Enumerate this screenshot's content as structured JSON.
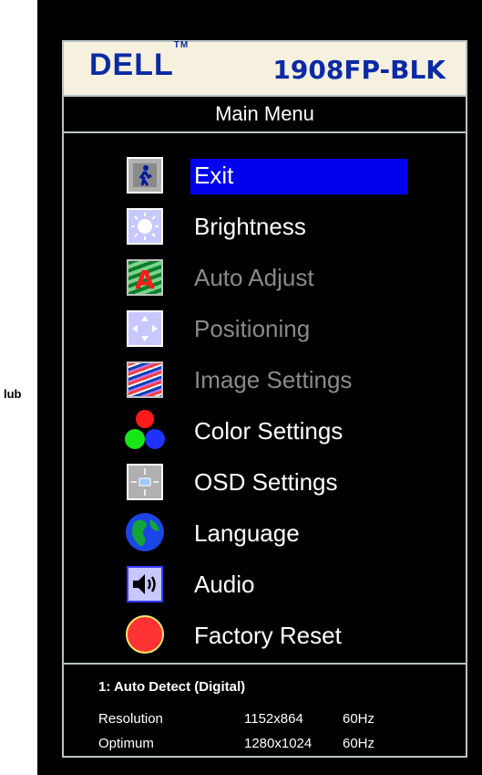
{
  "page": {
    "left_text": "lub"
  },
  "osd": {
    "brand": {
      "logo": "DELL",
      "trademark": "TM",
      "model": "1908FP-BLK"
    },
    "title": "Main Menu",
    "menu": [
      {
        "label": "Exit",
        "icon": "exit-icon",
        "selected": true,
        "enabled": true
      },
      {
        "label": "Brightness",
        "icon": "brightness-icon",
        "selected": false,
        "enabled": true
      },
      {
        "label": "Auto Adjust",
        "icon": "auto-adjust-icon",
        "selected": false,
        "enabled": false
      },
      {
        "label": "Positioning",
        "icon": "positioning-icon",
        "selected": false,
        "enabled": false
      },
      {
        "label": "Image Settings",
        "icon": "image-settings-icon",
        "selected": false,
        "enabled": false
      },
      {
        "label": "Color Settings",
        "icon": "color-settings-icon",
        "selected": false,
        "enabled": true
      },
      {
        "label": "OSD Settings",
        "icon": "osd-settings-icon",
        "selected": false,
        "enabled": true
      },
      {
        "label": "Language",
        "icon": "language-icon",
        "selected": false,
        "enabled": true
      },
      {
        "label": "Audio",
        "icon": "audio-icon",
        "selected": false,
        "enabled": true
      },
      {
        "label": "Factory Reset",
        "icon": "factory-reset-icon",
        "selected": false,
        "enabled": true
      }
    ],
    "status": {
      "input": "1: Auto Detect (Digital)",
      "resolution_label": "Resolution",
      "resolution_value": "1152x864",
      "resolution_rate": "60Hz",
      "optimum_label": "Optimum",
      "optimum_value": "1280x1024",
      "optimum_rate": "60Hz"
    },
    "colors": {
      "accent": "#0000ee",
      "brand": "#0b2aa5",
      "disabled": "#8a8a8a",
      "border": "#b9c4c4"
    }
  }
}
